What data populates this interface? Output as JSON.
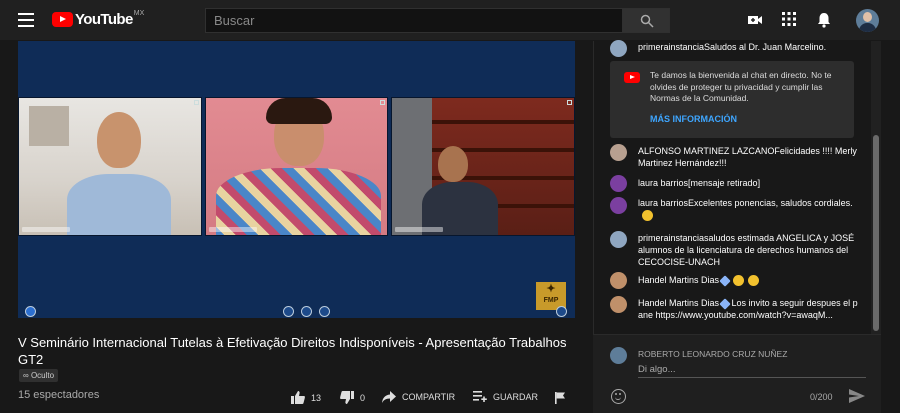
{
  "header": {
    "logo_text": "YouTube",
    "logo_region": "MX",
    "search_placeholder": "Buscar",
    "icons": [
      "menu-icon",
      "search-icon",
      "create-video-icon",
      "apps-grid-icon",
      "notifications-bell-icon",
      "account-avatar"
    ]
  },
  "video": {
    "watermark_mark": "✦",
    "watermark_text": "FMP"
  },
  "info": {
    "title": "V Seminário Internacional Tutelas à Efetivação Direitos Indisponíveis - Apresentação Trabalhos GT2",
    "visibility": "Oculto",
    "viewers": "15 espectadores",
    "likes": "13",
    "dislikes": "0",
    "share_label": "COMPARTIR",
    "save_label": "GUARDAR"
  },
  "chat": {
    "messages": [
      {
        "author": "primerainstancia",
        "text": "Saludos al Dr. Juan Marcelino."
      },
      {
        "author": "ALFONSO MARTINEZ LAZCANO",
        "text": "Felicidades !!!! Merly Martinez Hernández!!!"
      },
      {
        "author": "laura barrios",
        "text": "[mensaje retirado]"
      },
      {
        "author": "laura barrios",
        "text": "Excelentes ponencias, saludos cordiales."
      },
      {
        "author": "primerainstancia",
        "text": "saludos estimada ANGELICA y JOSÉ alumnos de la licenciatura de derechos humanos del CECOCISE-UNACH"
      },
      {
        "author": "Handel Martins Dias",
        "text": ""
      },
      {
        "author": "Handel Martins Dias",
        "text": "Los invito a seguir despues el pane",
        "link": "https://www.youtube.com/watch?v=awaqM..."
      }
    ],
    "welcome": {
      "text": "Te damos la bienvenida al chat en directo. No te olvides de proteger tu privacidad y cumplir las Normas de la Comunidad.",
      "link": "MÁS INFORMACIÓN"
    },
    "composer": {
      "user_name": "ROBERTO LEONARDO CRUZ NUÑEZ",
      "placeholder": "Di algo...",
      "counter": "0/200"
    }
  },
  "colors": {
    "background": "#181818",
    "topbar": "#202020",
    "brand_red": "#ff0000",
    "link_blue": "#3ea6ff",
    "member_blue": "#5e84f1"
  }
}
